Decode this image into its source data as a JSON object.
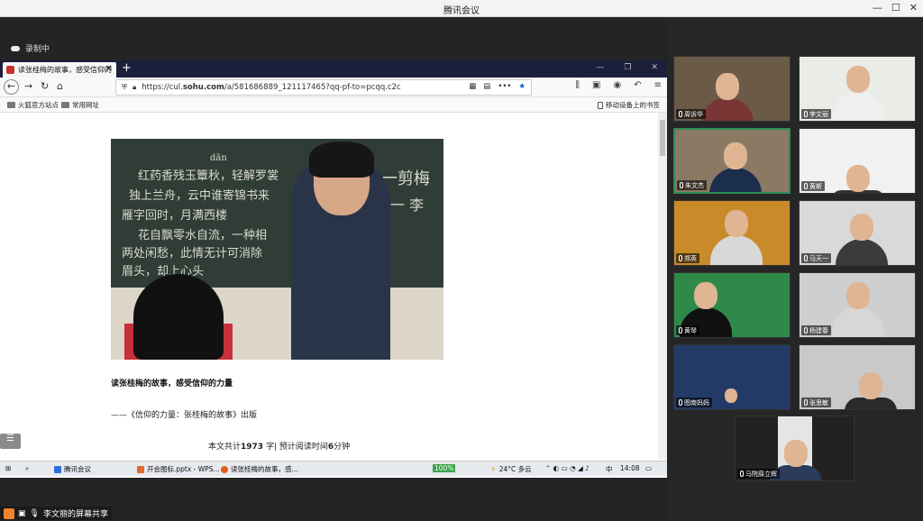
{
  "window": {
    "title": "腾讯会议",
    "controls": [
      "—",
      "☐",
      "✕"
    ]
  },
  "recording": {
    "label": "录制中"
  },
  "browser": {
    "tab_title": "读张桂梅的故事，感受信仰的",
    "tab_close": "✕",
    "new_tab": "+",
    "url_prefix": "https://cul.",
    "url_domain": "sohu.com",
    "url_rest": "/a/581686889_121117465?qq-pf-to=pcqq.c2c",
    "bookmarks": [
      "火狐官方站点",
      "常用网址"
    ],
    "mobile_bookmarks": "移动设备上的书签"
  },
  "article": {
    "title": "读张桂梅的故事，感受信仰的力量",
    "subtitle": "——《信仰的力量：张桂梅的故事》出版",
    "count_prefix": "本文共计",
    "count_words": "1973",
    "count_mid": " 字| 预计阅读时间",
    "count_minutes": "6",
    "count_suffix": "分钟",
    "photo_chalk": [
      "dān",
      "红药香残玉簟秋，轻解罗裳",
      "独上兰舟，云中谁寄锦书来",
      "雁字回时，月满西楼",
      "花自飘零水自流，一种相",
      "两处闲愁，此情无计可消除",
      "眉头，却上心头",
      "一剪梅",
      "一 李"
    ]
  },
  "taskbar": {
    "items": [
      "腾讯会议",
      "开会图标.pptx - WPS...",
      "读张桂梅的故事，感..."
    ],
    "battery": "100%",
    "weather": "24°C 多云",
    "ime": "中",
    "time": "14:08"
  },
  "share_label": "李文丽的屏幕共享",
  "participants": [
    {
      "name": "周诉华",
      "bg": "#6b5a48",
      "body": "#7a3535"
    },
    {
      "name": "李文丽",
      "bg": "#e9ece7",
      "body": "#efefef"
    },
    {
      "name": "朱文杰",
      "bg": "#8a7a64",
      "body": "#1c2e4d"
    },
    {
      "name": "黄斯",
      "bg": "#f1f1f1",
      "body": "#333333"
    },
    {
      "name": "郑英",
      "bg": "#c98b2a",
      "body": "#d8d8d8"
    },
    {
      "name": "马天一",
      "bg": "#d9d9d9",
      "body": "#3b3b3b"
    },
    {
      "name": "黄琴",
      "bg": "#2f8a4a",
      "body": "#111111"
    },
    {
      "name": "杨建春",
      "bg": "#cfcfcf",
      "body": "#d7d7d7"
    },
    {
      "name": "图南妈妈",
      "bg": "#243a66",
      "body": "#3a3a3a"
    },
    {
      "name": "张思敏",
      "bg": "#c9c9c9",
      "body": "#2a2a2a"
    },
    {
      "name": "马院薛立辉",
      "bg": "#e5e5e5",
      "body": "#2b3b5b"
    }
  ]
}
